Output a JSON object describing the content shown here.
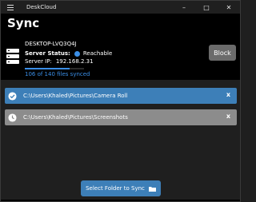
{
  "window": {
    "title": "DeskCloud",
    "controls": {
      "minimize": "–",
      "maximize": "□",
      "close": "✕"
    }
  },
  "page": {
    "heading": "Sync"
  },
  "server": {
    "name": "DESKTOP-LVQ3Q4J",
    "status_label": "Server Status:",
    "status_value": "Reachable",
    "ip_label": "Server IP:",
    "ip_value": "192.168.2.31",
    "progress_text": "106 of 140 files synced",
    "progress_fraction": 0.757
  },
  "block_button": {
    "label": "Block"
  },
  "folders": [
    {
      "path": "C:\\Users\\Khaled\\Pictures\\Camera Roll",
      "state": "synced",
      "remove": "x"
    },
    {
      "path": "C:\\Users\\Khaled\\Pictures\\Screenshots",
      "state": "pending",
      "remove": "x"
    }
  ],
  "select_button": {
    "label": "Select Folder to Sync",
    "icon": "folder-icon"
  },
  "colors": {
    "accent": "#3a8ee6",
    "row_active": "#3d7fb8",
    "row_pending": "#8c8c8c",
    "button_gray": "#6b6b6b"
  }
}
